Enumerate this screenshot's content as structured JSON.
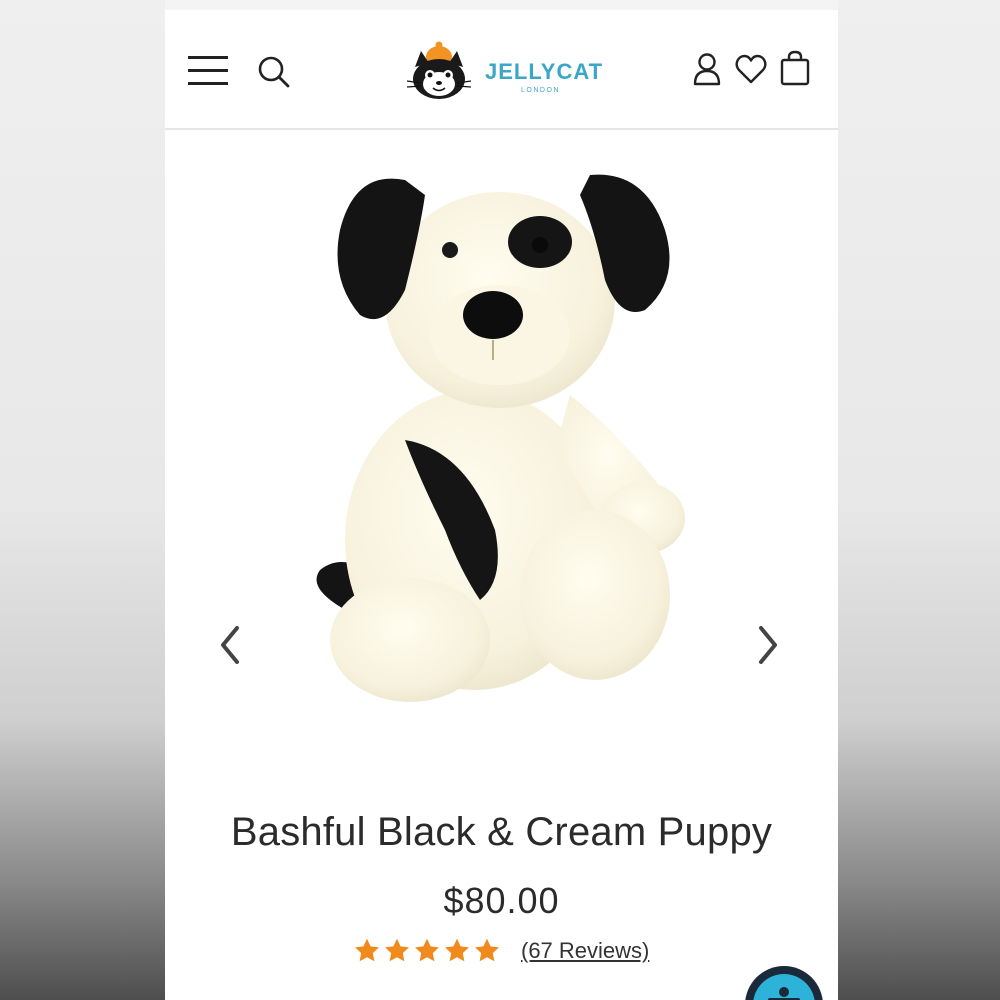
{
  "header": {
    "brand": "JELLYCAT",
    "brand_sub": "LONDON",
    "icons": [
      "menu-icon",
      "search-icon",
      "user-icon",
      "heart-icon",
      "bag-icon"
    ]
  },
  "product": {
    "title": "Bashful Black & Cream Puppy",
    "price": "$80.00",
    "rating": 5,
    "reviews_label": "(67 Reviews)",
    "image_subject": "plush puppy"
  },
  "colors": {
    "star": "#f08a1c",
    "brand_teal": "#3aa6c8",
    "text": "#2b2b2b",
    "help_bubble": "#2db3d8"
  }
}
